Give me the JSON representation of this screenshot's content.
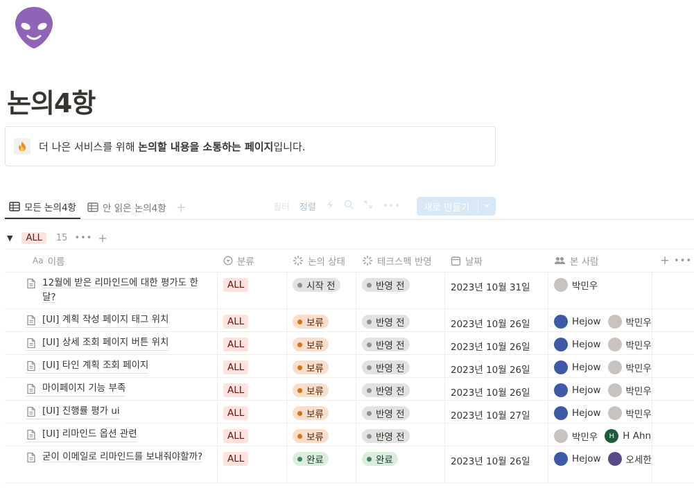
{
  "page": {
    "title": "논의4항",
    "icon": "alien-icon"
  },
  "callout": {
    "icon": "fire-icon",
    "prefix": "더 나은 서비스를 위해 ",
    "bold": "논의할 내용을 소통하는 페이지",
    "suffix": "입니다."
  },
  "tabs": [
    {
      "label": "모든 논의4항",
      "active": true
    },
    {
      "label": "안 읽은 논의4항",
      "active": false
    }
  ],
  "toolbar": {
    "filter": "필터",
    "sort": "정렬",
    "new_label": "새로 만들기"
  },
  "group": {
    "label": "ALL",
    "count": "15"
  },
  "columns": {
    "name": "이름",
    "category": "분류",
    "status": "논의 상태",
    "tech": "테크스펙 반영",
    "date": "날짜",
    "seen": "본 사람"
  },
  "rows": [
    {
      "name": "12월에 받은 리마인드에 대한 평가도 한 달?",
      "category": "ALL",
      "status": "시작 전",
      "status_color": "gray",
      "tech": "반영 전",
      "tech_color": "gray",
      "date": "2023년 10월 31일",
      "people": [
        "박민우"
      ]
    },
    {
      "name": "[UI] 계획 작성 페이지 태그 위치",
      "category": "ALL",
      "status": "보류",
      "status_color": "orange",
      "tech": "반영 전",
      "tech_color": "gray",
      "date": "2023년 10월 26일",
      "people": [
        "Hejow",
        "박민우"
      ]
    },
    {
      "name": "[UI] 상세 조회 페이지 버튼 위치",
      "category": "ALL",
      "status": "보류",
      "status_color": "orange",
      "tech": "반영 전",
      "tech_color": "gray",
      "date": "2023년 10월 26일",
      "people": [
        "Hejow",
        "박민우"
      ]
    },
    {
      "name": "[UI] 타인 계획 조회 페이지",
      "category": "ALL",
      "status": "보류",
      "status_color": "orange",
      "tech": "반영 전",
      "tech_color": "gray",
      "date": "2023년 10월 26일",
      "people": [
        "Hejow",
        "박민우"
      ]
    },
    {
      "name": "마이페이지 기능 부족",
      "category": "ALL",
      "status": "보류",
      "status_color": "orange",
      "tech": "반영 전",
      "tech_color": "gray",
      "date": "2023년 10월 26일",
      "people": [
        "Hejow",
        "박민우"
      ]
    },
    {
      "name": "[UI] 진행률 평가 ui",
      "category": "ALL",
      "status": "보류",
      "status_color": "orange",
      "tech": "반영 전",
      "tech_color": "gray",
      "date": "2023년 10월 27일",
      "people": [
        "Hejow",
        "박민우"
      ]
    },
    {
      "name": "[UI] 리마인드 옵션 관련",
      "category": "ALL",
      "status": "보류",
      "status_color": "orange",
      "tech": "반영 전",
      "tech_color": "gray",
      "date": "",
      "people": [
        "박민우",
        "H Ahn"
      ]
    },
    {
      "name": "굳이 이메일로 리마인드를 보내줘야할까?",
      "category": "ALL",
      "status": "완료",
      "status_color": "green",
      "tech": "완료",
      "tech_color": "green",
      "date": "2023년 10월 26일",
      "people": [
        "Hejow",
        "오세한"
      ]
    }
  ]
}
